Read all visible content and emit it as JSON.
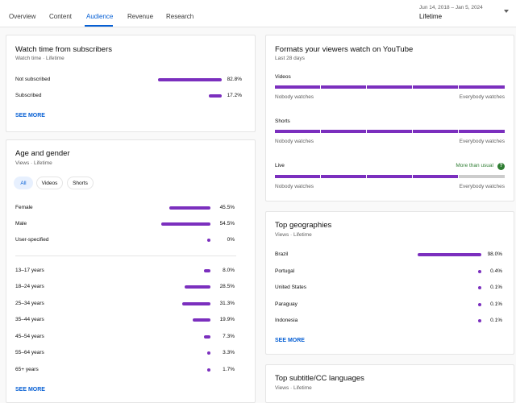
{
  "tabs": [
    "Overview",
    "Content",
    "Audience",
    "Revenue",
    "Research"
  ],
  "date_range": {
    "dates": "Jun 14, 2018 – Jan 5, 2024",
    "period": "Lifetime"
  },
  "subscribers_card": {
    "title": "Watch time from subscribers",
    "subtitle": "Watch time · Lifetime",
    "rows": [
      {
        "label": "Not subscribed",
        "value": "82.8%",
        "share": 0.828
      },
      {
        "label": "Subscribed",
        "value": "17.2%",
        "share": 0.172
      }
    ],
    "see_more": "SEE MORE"
  },
  "age_gender_card": {
    "title": "Age and gender",
    "subtitle": "Views · Lifetime",
    "chips": [
      "All",
      "Videos",
      "Shorts"
    ],
    "gender_rows": [
      {
        "label": "Female",
        "value": "45.5%",
        "share": 0.455
      },
      {
        "label": "Male",
        "value": "54.5%",
        "share": 0.545
      },
      {
        "label": "User-specified",
        "value": "0%",
        "share": 0
      }
    ],
    "age_rows": [
      {
        "label": "13–17 years",
        "value": "8.0%",
        "share": 0.08
      },
      {
        "label": "18–24 years",
        "value": "28.5%",
        "share": 0.285
      },
      {
        "label": "25–34 years",
        "value": "31.3%",
        "share": 0.313
      },
      {
        "label": "35–44 years",
        "value": "19.9%",
        "share": 0.199
      },
      {
        "label": "45–54 years",
        "value": "7.3%",
        "share": 0.073
      },
      {
        "label": "55–64 years",
        "value": "3.3%",
        "share": 0.033
      },
      {
        "label": "65+ years",
        "value": "1.7%",
        "share": 0.017
      }
    ],
    "see_more": "SEE MORE"
  },
  "formats_card": {
    "title": "Formats your viewers watch on YouTube",
    "subtitle": "Last 28 days",
    "low_label": "Nobody watches",
    "high_label": "Everybody watches",
    "formats": [
      {
        "label": "Videos",
        "level": 1.0
      },
      {
        "label": "Shorts",
        "level": 1.0
      },
      {
        "label": "Live",
        "level": 0.8,
        "note": "More than usual"
      }
    ],
    "note_icon": "?"
  },
  "geo_card": {
    "title": "Top geographies",
    "subtitle": "Views · Lifetime",
    "rows": [
      {
        "label": "Brazil",
        "value": "98.0%",
        "share": 0.98
      },
      {
        "label": "Portugal",
        "value": "0.4%",
        "share": 0.004
      },
      {
        "label": "United States",
        "value": "0.1%",
        "share": 0.001
      },
      {
        "label": "Paraguay",
        "value": "0.1%",
        "share": 0.001
      },
      {
        "label": "Indonesia",
        "value": "0.1%",
        "share": 0.001
      }
    ],
    "see_more": "SEE MORE"
  },
  "languages_card": {
    "title": "Top subtitle/CC languages",
    "subtitle": "Views · Lifetime"
  },
  "colors": {
    "bar": "#7b2fbe",
    "accent": "#065fd4",
    "positive": "#2e7d32"
  }
}
